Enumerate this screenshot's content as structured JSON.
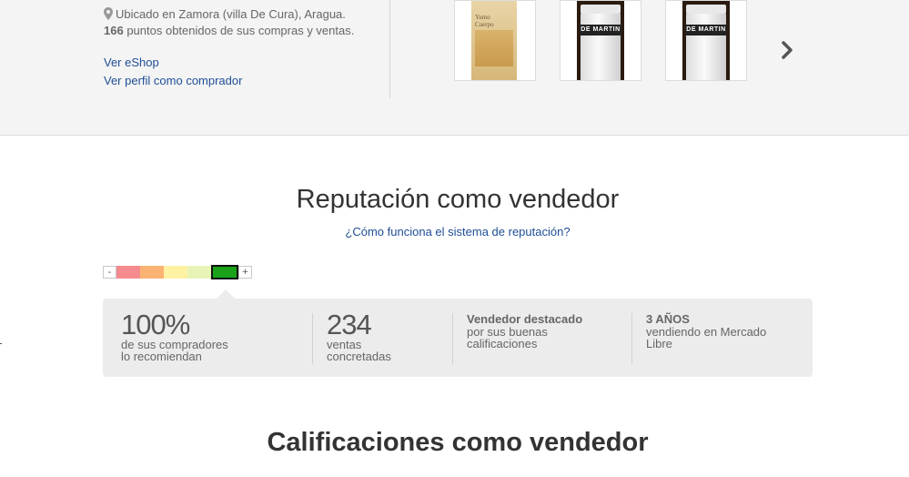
{
  "seller": {
    "location": "Ubicado en Zamora (villa De Cura), Aragua.",
    "points_count": "166",
    "points_text": " puntos obtenidos de sus compras y ventas.",
    "link_eshop": "Ver eShop",
    "link_buyer_profile": "Ver perfil como comprador"
  },
  "carousel": {
    "items": [
      {
        "icon": "book-photo",
        "label_lines": [
          "Yumo",
          "Cuerpo"
        ]
      },
      {
        "icon": "jar-photo",
        "label": "DE MARTIN"
      },
      {
        "icon": "jar-photo",
        "label": "DE MARTIN"
      }
    ],
    "next_icon": "chevron-right-icon"
  },
  "reputation": {
    "title": "Reputación como vendedor",
    "help_link": "¿Cómo funciona el sistema de reputación?",
    "thermometer": {
      "minus": "-",
      "plus": "+",
      "levels": [
        "#f58b8f",
        "#fbb374",
        "#fff2a3",
        "#e8f4b6",
        "#1aa31a"
      ],
      "active_level": 5
    },
    "stats": {
      "recommend_value": "100%",
      "recommend_line1": "de sus compradores",
      "recommend_line2": "lo recomiendan",
      "sales_value": "234",
      "sales_line1": "ventas",
      "sales_line2": "concretadas",
      "badge_title": "Vendedor destacado",
      "badge_line1": "por sus buenas",
      "badge_line2": "calificaciones",
      "years_title": "3 AÑOS",
      "years_line1": "vendiendo en Mercado",
      "years_line2": "Libre"
    }
  },
  "ratings": {
    "title": "Calificaciones como vendedor"
  }
}
